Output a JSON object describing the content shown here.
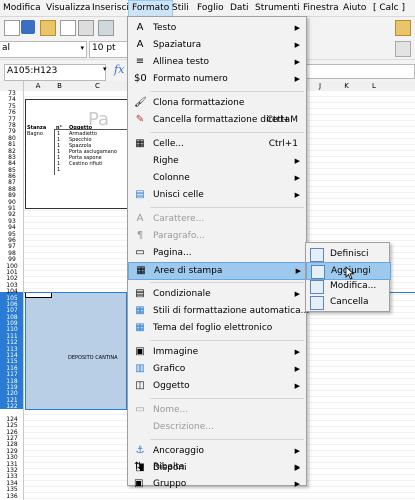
{
  "menubar": {
    "items": [
      "Modifica",
      "Visualizza",
      "Inserisci",
      "Formato",
      "Stili",
      "Foglio",
      "Dati",
      "Strumenti",
      "Finestra",
      "Aiuto",
      "[ Calc ]"
    ]
  },
  "toolbar": {
    "font_name": "al",
    "font_size": "10 pt"
  },
  "formula": {
    "name_box": "A105:H123",
    "fx": "fx"
  },
  "grid": {
    "columns": [
      "A",
      "B",
      "C",
      "J",
      "K",
      "L"
    ],
    "row_start": 73,
    "row_end": 136,
    "header_cells": [
      "Stanza",
      "n°",
      "Oggetto"
    ],
    "room": "Bagno",
    "items": [
      "Armadietto",
      "Specchio",
      "Spazzola",
      "Porta asciugamano",
      "Porta sapone",
      "Cestino rifiuti"
    ],
    "counts": [
      "1",
      "1",
      "1",
      "1",
      "1",
      "1",
      "1"
    ],
    "deposit_label": "DEPOSITO CANTINA",
    "watermark": "Pa"
  },
  "menu": {
    "items": [
      {
        "label": "Testo",
        "icon": "text-A-icon",
        "arrow": true
      },
      {
        "label": "Spaziatura",
        "icon": "spacing-A-icon",
        "arrow": true
      },
      {
        "label": "Allinea testo",
        "icon": "align-text-icon",
        "arrow": true
      },
      {
        "label": "Formato numero",
        "icon": "number-format-icon",
        "arrow": true
      },
      {
        "label": "Clona formattazione",
        "icon": "clone-format-icon"
      },
      {
        "label": "Cancella formattazione diretta",
        "shortcut": "Ctrl+M",
        "icon": "clear-format-icon"
      },
      {
        "label": "Celle...",
        "shortcut": "Ctrl+1",
        "icon": "cells-icon"
      },
      {
        "label": "Righe",
        "arrow": true
      },
      {
        "label": "Colonne",
        "arrow": true
      },
      {
        "label": "Unisci celle",
        "icon": "merge-cells-icon",
        "arrow": true
      },
      {
        "label": "Carattere...",
        "disabled": true,
        "icon": "character-icon"
      },
      {
        "label": "Paragrafo...",
        "disabled": true,
        "icon": "paragraph-icon"
      },
      {
        "label": "Pagina...",
        "icon": "page-icon"
      },
      {
        "label": "Aree di stampa",
        "icon": "print-range-icon",
        "arrow": true,
        "highlighted": true
      },
      {
        "label": "Condizionale",
        "icon": "conditional-icon",
        "arrow": true
      },
      {
        "label": "Stili di formattazione automatica...",
        "icon": "autoformat-icon"
      },
      {
        "label": "Tema del foglio elettronico",
        "icon": "theme-icon"
      },
      {
        "label": "Immagine",
        "icon": "image-icon",
        "arrow": true
      },
      {
        "label": "Grafico",
        "icon": "chart-icon",
        "arrow": true
      },
      {
        "label": "Oggetto",
        "icon": "object-icon",
        "arrow": true
      },
      {
        "label": "Nome...",
        "disabled": true,
        "icon": "name-icon"
      },
      {
        "label": "Descrizione...",
        "disabled": true
      },
      {
        "label": "Ancoraggio",
        "icon": "anchor-icon",
        "arrow": true
      },
      {
        "label": "Disponi",
        "icon": "arrange-icon",
        "arrow": true
      },
      {
        "label": "Ribalta",
        "icon": "flip-icon",
        "arrow": true
      },
      {
        "label": "Gruppo",
        "icon": "group-icon",
        "arrow": true
      }
    ]
  },
  "submenu": {
    "items": [
      {
        "label": "Definisci",
        "icon": "define-range-icon"
      },
      {
        "label": "Aggiungi",
        "icon": "add-range-icon",
        "highlighted": true
      },
      {
        "label": "Modifica...",
        "icon": "edit-range-icon"
      },
      {
        "label": "Cancella",
        "icon": "clear-range-icon"
      }
    ]
  },
  "colors": {
    "menu_highlight": "#9ec9ee",
    "selection": "#b8cfe6",
    "row_header_selected": "#2a7bd3"
  }
}
